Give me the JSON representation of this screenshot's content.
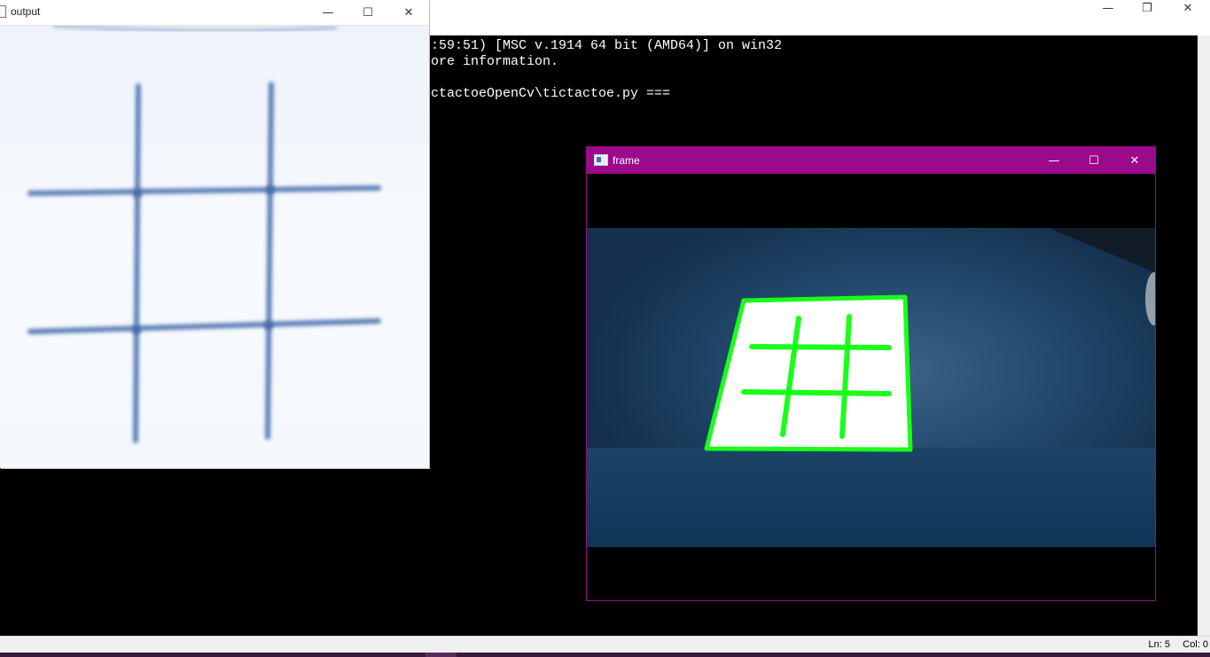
{
  "shell": {
    "lines": [
      ":59:51) [MSC v.1914 64 bit (AMD64)] on win32",
      "ore information.",
      "",
      "ctactoeOpenCv\\tictactoe.py ==="
    ],
    "controls": {
      "minimize": "—",
      "restore": "❐",
      "close": "✕"
    }
  },
  "statusbar": {
    "line": "Ln: 5",
    "column": "Col: 0"
  },
  "output_window": {
    "title": "output",
    "controls": {
      "minimize": "—",
      "maximize": "☐",
      "close": "✕"
    },
    "image": {
      "background": "#f5f9fe",
      "ink": "#5b7eb8"
    }
  },
  "frame_window": {
    "title": "frame",
    "controls": {
      "minimize": "—",
      "maximize": "☐",
      "close": "✕"
    },
    "accent": "#9b0a8b",
    "image": {
      "background": "#1e3a57",
      "paper": "#ffffff",
      "outline": "#19ff19"
    }
  }
}
